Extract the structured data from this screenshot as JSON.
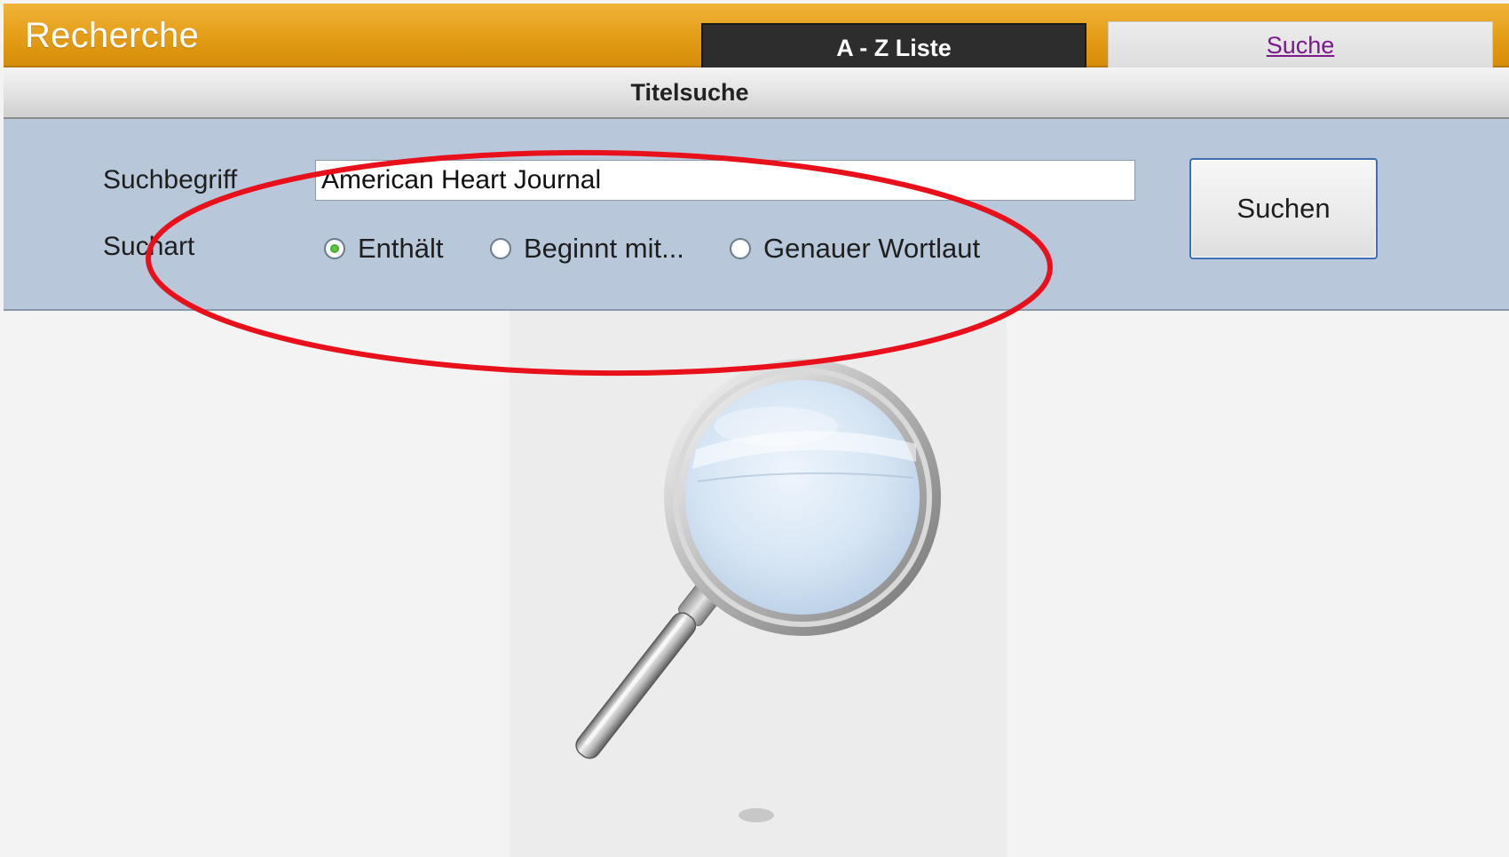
{
  "header": {
    "title": "Recherche",
    "tabs": [
      {
        "label": "A - Z Liste"
      },
      {
        "label": "Suche"
      }
    ]
  },
  "subheader": {
    "title": "Titelsuche"
  },
  "search_form": {
    "term_label": "Suchbegriff",
    "term_value": "American Heart Journal",
    "mode_label": "Suchart",
    "mode_options": [
      {
        "label": "Enthält",
        "checked": true
      },
      {
        "label": "Beginnt mit...",
        "checked": false
      },
      {
        "label": "Genauer Wortlaut",
        "checked": false
      }
    ],
    "submit_label": "Suchen"
  },
  "colors": {
    "header_orange": "#e49d16",
    "panel_blue": "#b8c8da",
    "annotation_red": "#e8101a",
    "visited_link": "#7a1a8a"
  },
  "icons": {
    "illustration": "magnifier-icon",
    "annotation": "red-ellipse"
  }
}
